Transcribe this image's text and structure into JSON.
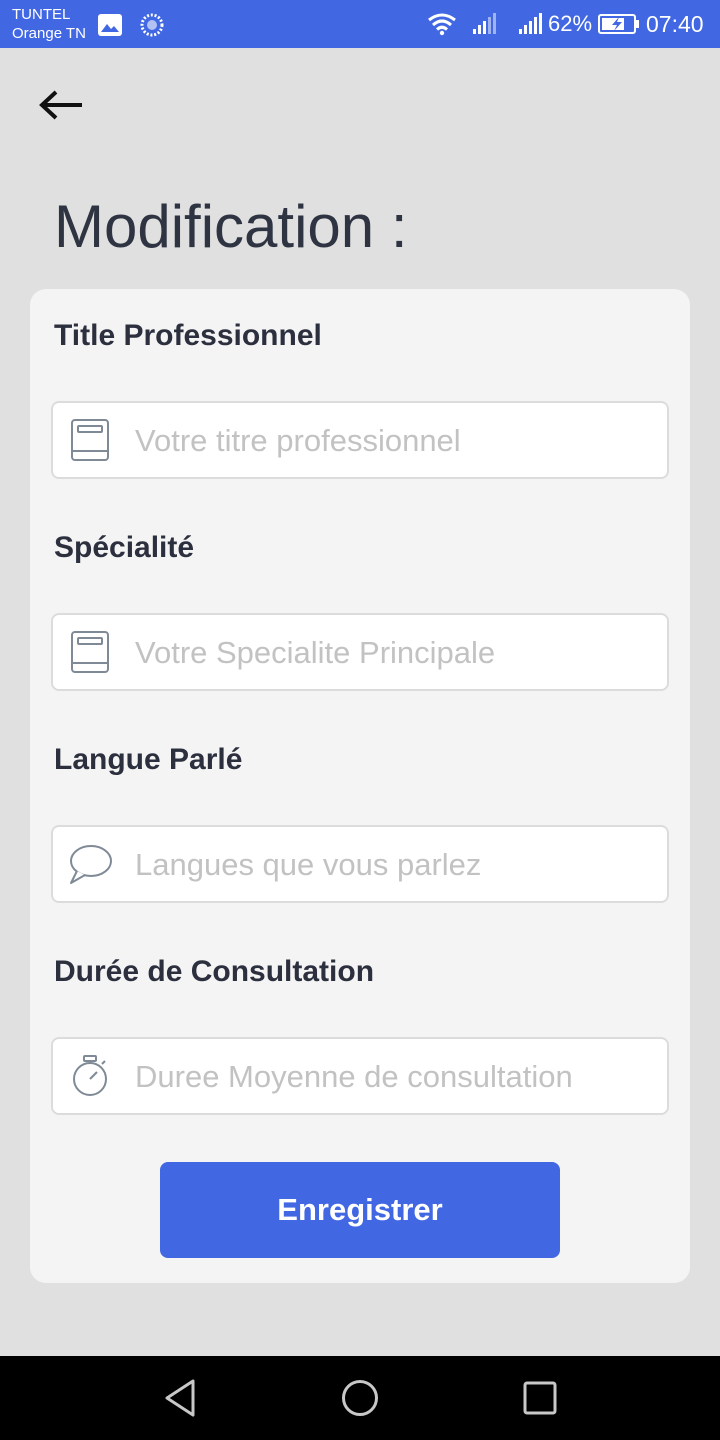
{
  "status_bar": {
    "carrier_line1": "TUNTEL",
    "carrier_line2": "Orange TN",
    "battery_percent": "62%",
    "time": "07:40",
    "icons": [
      "image-icon",
      "sync-icon",
      "wifi-icon",
      "signal-icon",
      "signal-icon",
      "battery-charging-icon"
    ]
  },
  "header": {
    "back_icon": "arrow-left-icon",
    "title": "Modification :"
  },
  "form": {
    "fields": [
      {
        "label": "Title Professionnel",
        "placeholder": "Votre titre professionnel",
        "icon": "book-icon"
      },
      {
        "label": "Spécialité",
        "placeholder": "Votre Specialite Principale",
        "icon": "book-icon"
      },
      {
        "label": "Langue Parlé",
        "placeholder": "Langues que vous parlez",
        "icon": "chat-bubble-icon"
      },
      {
        "label": "Durée de Consultation",
        "placeholder": "Duree Moyenne de consultation",
        "icon": "stopwatch-icon"
      }
    ],
    "submit_label": "Enregistrer"
  },
  "nav_bar": {
    "icons": [
      "nav-back-icon",
      "nav-home-icon",
      "nav-recents-icon"
    ]
  },
  "colors": {
    "accent": "#4167e3",
    "background": "#e0e0e0",
    "card": "#f4f4f4",
    "label_text": "#2c2f3e",
    "placeholder": "#c2c2c2"
  }
}
